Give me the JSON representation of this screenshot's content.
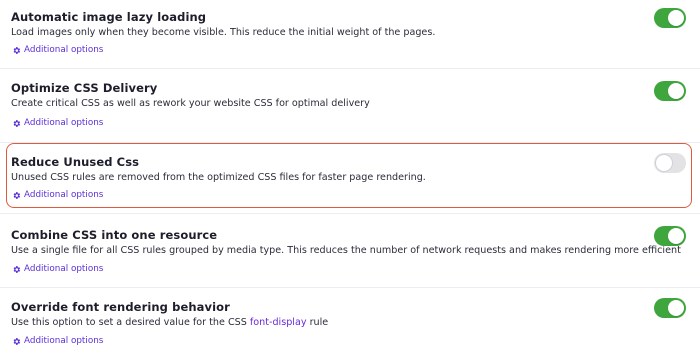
{
  "settings": [
    {
      "title": "Automatic image lazy loading",
      "description": "Load images only when they become visible. This reduce the initial weight of the pages.",
      "description_link": "",
      "description_suffix": "",
      "options_label": "Additional options",
      "enabled": true
    },
    {
      "title": "Optimize CSS Delivery",
      "description": "Create critical CSS as well as rework your website CSS for optimal delivery",
      "description_link": "",
      "description_suffix": "",
      "options_label": "Additional options",
      "enabled": true
    },
    {
      "title": "Reduce Unused Css",
      "description": "Unused CSS rules are removed from the optimized CSS files for faster page rendering.",
      "description_link": "",
      "description_suffix": "",
      "options_label": "Additional options",
      "enabled": false,
      "highlighted": true
    },
    {
      "title": "Combine CSS into one resource",
      "description": "Use a single file for all CSS rules grouped by media type. This reduces the number of network requests and makes rendering more efficient",
      "description_link": "",
      "description_suffix": "",
      "options_label": "Additional options",
      "enabled": true
    },
    {
      "title": "Override font rendering behavior",
      "description": "Use this option to set a desired value for the CSS ",
      "description_link": "font-display",
      "description_suffix": " rule",
      "options_label": "Additional options",
      "enabled": true
    }
  ],
  "colors": {
    "toggle_on": "#3ea63d",
    "toggle_off": "#e3e3e6",
    "link": "#5a2fd6",
    "highlight_border": "#e25a3e"
  },
  "icons": {
    "options": "gear-icon"
  }
}
